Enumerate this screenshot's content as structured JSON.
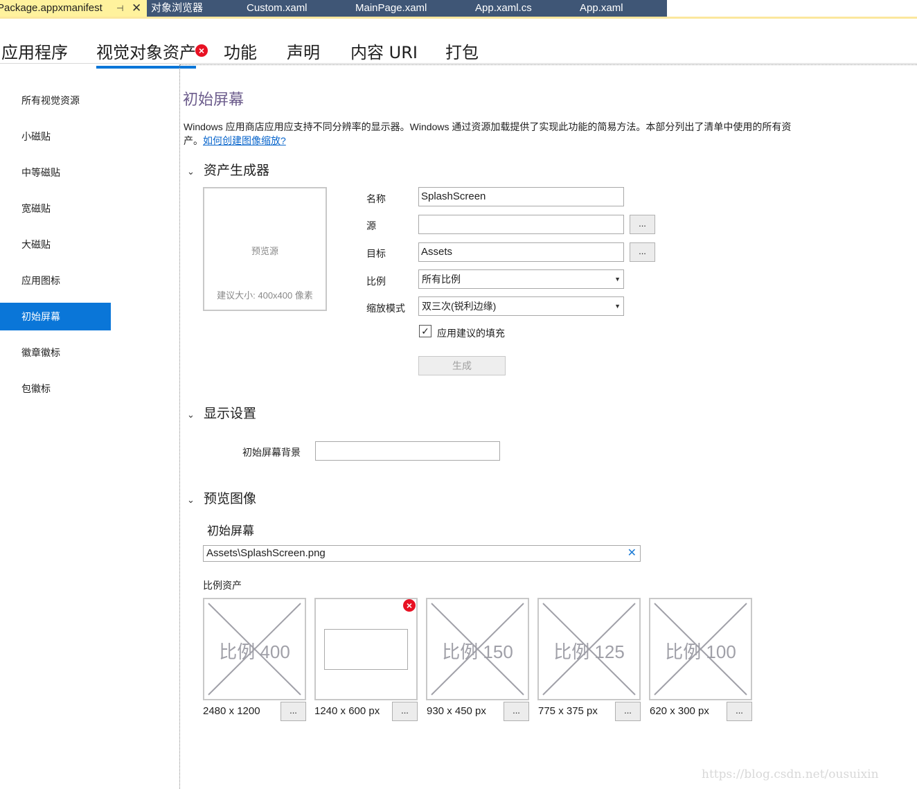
{
  "doc_tabs": [
    {
      "label": "Package.appxmanifest",
      "active": true
    },
    {
      "label": "对象浏览器"
    },
    {
      "label": "Custom.xaml"
    },
    {
      "label": "MainPage.xaml"
    },
    {
      "label": "App.xaml.cs"
    },
    {
      "label": "App.xaml"
    }
  ],
  "doc_tab_pin": "⊣",
  "doc_tab_close": "✕",
  "section_tabs": [
    {
      "label": "应用程序"
    },
    {
      "label": "视觉对象资产",
      "selected": true,
      "error": true
    },
    {
      "label": "功能"
    },
    {
      "label": "声明"
    },
    {
      "label": "内容 URI"
    },
    {
      "label": "打包"
    }
  ],
  "nav": {
    "items": [
      {
        "label": "所有视觉资源"
      },
      {
        "label": "小磁贴"
      },
      {
        "label": "中等磁贴"
      },
      {
        "label": "宽磁贴"
      },
      {
        "label": "大磁贴"
      },
      {
        "label": "应用图标"
      },
      {
        "label": "初始屏幕",
        "selected": true
      },
      {
        "label": "徽章徽标"
      },
      {
        "label": "包徽标"
      }
    ]
  },
  "page": {
    "title": "初始屏幕",
    "description": "Windows 应用商店应用应支持不同分辨率的显示器。Windows 通过资源加载提供了实现此功能的简易方法。本部分列出了清单中使用的所有资产。",
    "help_link": "如何创建图像缩放?"
  },
  "asset_generator": {
    "heading": "资产生成器",
    "preview_text": "预览源",
    "preview_hint": "建议大小: 400x400 像素",
    "name_label": "名称",
    "name_value": "SplashScreen",
    "source_label": "源",
    "source_value": "",
    "target_label": "目标",
    "target_value": "Assets",
    "browse_label": "...",
    "scale_label": "比例",
    "scale_value": "所有比例",
    "mode_label": "缩放模式",
    "mode_value": "双三次(锐利边缘)",
    "padding_checked": true,
    "padding_label": "应用建议的填充",
    "generate_label": "生成"
  },
  "display_settings": {
    "heading": "显示设置",
    "bg_label": "初始屏幕背景",
    "bg_value": ""
  },
  "preview_images": {
    "heading": "预览图像",
    "subheading": "初始屏幕",
    "path_value": "Assets\\SplashScreen.png",
    "clear_icon": "✕",
    "scaled_heading": "比例资产",
    "assets": [
      {
        "label": "比例 400",
        "size": "2480 x 1200",
        "placeholder": true
      },
      {
        "label": "",
        "size": "1240 x 600 px",
        "placeholder": false,
        "error": true
      },
      {
        "label": "比例 150",
        "size": "930 x 450 px",
        "placeholder": true
      },
      {
        "label": "比例 125",
        "size": "775 x 375 px",
        "placeholder": true
      },
      {
        "label": "比例 100",
        "size": "620 x 300 px",
        "placeholder": true
      }
    ],
    "browse_label": "..."
  },
  "watermark": "https://blog.csdn.net/ousuixin",
  "colors": {
    "accent": "#0a76d8",
    "tab_strip": "#3f5676",
    "active_tab": "#fff29d",
    "title": "#6c5c8c",
    "error": "#e81123"
  }
}
